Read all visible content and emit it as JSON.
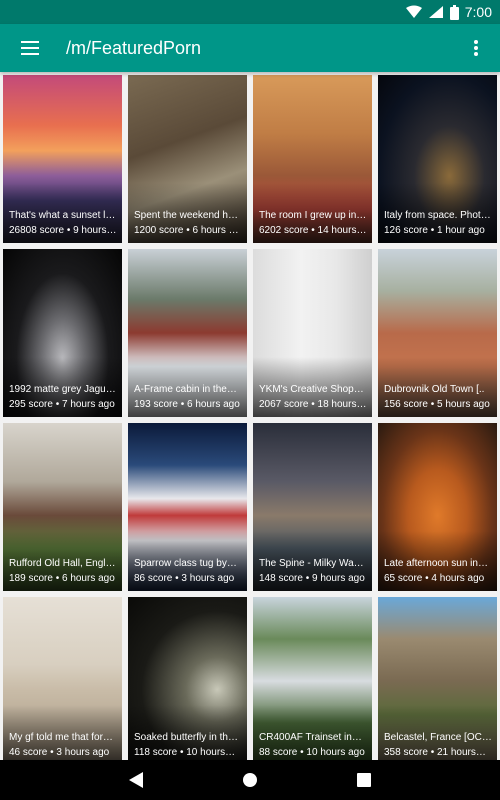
{
  "status": {
    "time": "7:00",
    "network": "LTE"
  },
  "app_bar": {
    "title": "/m/FeaturedPorn"
  },
  "icons": {
    "menu": "hamburger-menu-icon",
    "overflow": "more-vert-icon",
    "back": "back-triangle-icon",
    "home": "home-circle-icon",
    "recents": "recents-square-icon"
  },
  "colors": {
    "status_bar": "#00796b",
    "app_bar": "#009688",
    "background": "#f2f2f2",
    "nav_bar": "#000000"
  },
  "posts": [
    {
      "title": "That's what a sunset l…",
      "meta": "26808 score • 9 hours…"
    },
    {
      "title": "Spent the weekend he…",
      "meta": "1200 score • 6 hours a…"
    },
    {
      "title": "The room I grew up in…",
      "meta": "6202 score • 14 hours…"
    },
    {
      "title": "Italy from space. Phot…",
      "meta": "126 score • 1 hour ago"
    },
    {
      "title": "1992 matte grey Jagu…",
      "meta": "295 score • 7 hours ago"
    },
    {
      "title": "A-Frame cabin in the…",
      "meta": "193 score • 6 hours ago"
    },
    {
      "title": "YKM's Creative Shopp…",
      "meta": "2067 score • 18 hours…"
    },
    {
      "title": "Dubrovnik Old Town [..",
      "meta": "156 score • 5 hours ago"
    },
    {
      "title": "Rufford Old Hall, Engl…",
      "meta": "189 score • 6 hours ago"
    },
    {
      "title": "Sparrow class tug by…",
      "meta": "86 score • 3 hours ago"
    },
    {
      "title": "The Spine - Milky Way…",
      "meta": "148 score • 9 hours ago"
    },
    {
      "title": "Late afternoon sun in…",
      "meta": "65 score • 4 hours ago"
    },
    {
      "title": "My gf told me that for…",
      "meta": "46 score • 3 hours ago"
    },
    {
      "title": "Soaked butterfly in th…",
      "meta": "118 score • 10 hours…"
    },
    {
      "title": "CR400AF Trainset in…",
      "meta": "88 score • 10 hours ago"
    },
    {
      "title": "Belcastel, France [OC]…",
      "meta": "358 score • 21 hours…"
    }
  ]
}
